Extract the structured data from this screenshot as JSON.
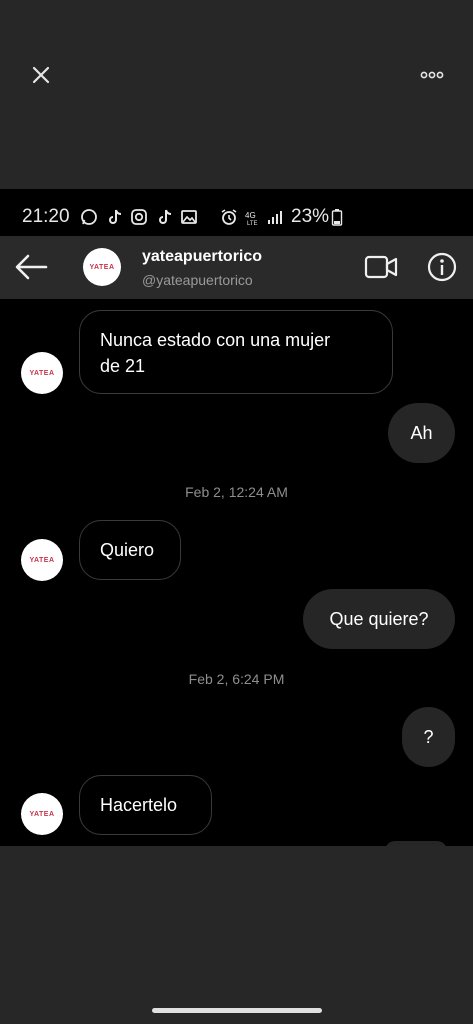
{
  "viewer": {
    "close_icon": "close-icon",
    "more_icon": "more-horizontal-icon"
  },
  "status_bar": {
    "time": "21:20",
    "icons": [
      "whatsapp-icon",
      "tiktok-icon",
      "instagram-icon",
      "tiktok-icon",
      "gallery-icon",
      "alarm-icon",
      "4g-lte-icon",
      "signal-icon"
    ],
    "battery_percent": "23%"
  },
  "header": {
    "username": "yateapuertorico",
    "handle": "@yateapuertorico",
    "avatar_text": "YATEA"
  },
  "messages": [
    {
      "sender": "them",
      "text_line1": "Nunca estado con una mujer",
      "text_line2": "de 21"
    },
    {
      "sender": "me",
      "text": "Ah"
    },
    {
      "type": "timestamp",
      "text": "Feb 2, 12:24 AM"
    },
    {
      "sender": "them",
      "text": "Quiero"
    },
    {
      "sender": "me",
      "text": "Que quiere?"
    },
    {
      "type": "timestamp",
      "text": "Feb 2, 6:24 PM"
    },
    {
      "sender": "me",
      "text": "?"
    },
    {
      "sender": "them",
      "text": "Hacertelo"
    }
  ],
  "avatar_text": "YATEA"
}
